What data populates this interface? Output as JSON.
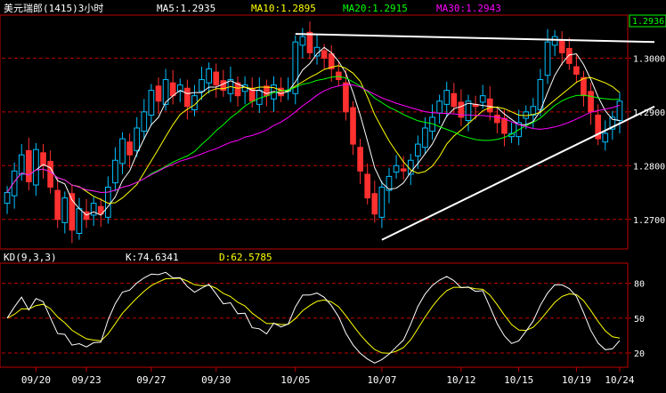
{
  "header": {
    "symbol": "美元瑞郎(1415)3小时",
    "ma5": "MA5:1.2935",
    "ma10": "MA10:1.2895",
    "ma20": "MA20:1.2915",
    "ma30": "MA30:1.2943",
    "last_price": "1.2936"
  },
  "kd_header": {
    "name": "KD(9,3,3)",
    "k": "K:74.6341",
    "d": "D:62.5785"
  },
  "colors": {
    "background": "#000000",
    "frame": "#c00000",
    "up_candle": "#00c0ff",
    "down_candle": "#ff3030",
    "ma5": "#ffffff",
    "ma10": "#ffff00",
    "ma20": "#00ff00",
    "ma30": "#ff00ff",
    "trendline": "#ffffff",
    "k_line": "#ffffff",
    "d_line": "#ffff00",
    "axis_text": "#ffffff",
    "header_text": "#ffffff"
  },
  "chart_data": [
    {
      "type": "candlestick",
      "title": "美元瑞郎(1415)3小时",
      "ylim": [
        1.265,
        1.3075
      ],
      "ytick_labels": [
        "1.3000",
        "1.2900",
        "1.2800",
        "1.2700"
      ],
      "yticks": [
        1.3,
        1.29,
        1.28,
        1.27
      ],
      "xtick_labels": [
        "09/20",
        "09/23",
        "09/27",
        "09/30",
        "10/05",
        "10/07",
        "10/12",
        "10/15",
        "10/19",
        "10/24"
      ],
      "close": [
        1.275,
        1.279,
        1.282,
        1.277,
        1.283,
        1.28,
        1.276,
        1.27,
        1.274,
        1.268,
        1.272,
        1.27,
        1.273,
        1.271,
        1.276,
        1.281,
        1.285,
        1.282,
        1.287,
        1.29,
        1.294,
        1.292,
        1.296,
        1.293,
        1.295,
        1.291,
        1.293,
        1.296,
        1.298,
        1.295,
        1.294,
        1.296,
        1.293,
        1.295,
        1.292,
        1.294,
        1.293,
        1.295,
        1.293,
        1.294,
        1.303,
        1.304,
        1.301,
        1.302,
        1.3,
        1.298,
        1.296,
        1.29,
        1.284,
        1.279,
        1.274,
        1.271,
        1.276,
        1.278,
        1.28,
        1.279,
        1.281,
        1.284,
        1.287,
        1.289,
        1.292,
        1.294,
        1.291,
        1.289,
        1.292,
        1.291,
        1.293,
        1.29,
        1.288,
        1.286,
        1.286,
        1.288,
        1.29,
        1.291,
        1.296,
        1.303,
        1.304,
        1.301,
        1.299,
        1.297,
        1.293,
        1.29,
        1.285,
        1.286,
        1.289,
        1.292
      ],
      "series": [
        {
          "name": "MA5",
          "value": 1.2935
        },
        {
          "name": "MA10",
          "value": 1.2895
        },
        {
          "name": "MA20",
          "value": 1.2915
        },
        {
          "name": "MA30",
          "value": 1.2943
        }
      ],
      "trendlines": [
        {
          "from": [
            "10/05",
            1.3045
          ],
          "to": [
            "10/24",
            1.303
          ]
        },
        {
          "from": [
            "10/07",
            1.2662
          ],
          "to": [
            "10/24",
            1.291
          ]
        }
      ]
    },
    {
      "type": "line",
      "title": "KD(9,3,3)",
      "ylim": [
        10,
        95
      ],
      "ytick_labels": [
        "80",
        "50",
        "20"
      ],
      "yticks": [
        80,
        50,
        20
      ],
      "series": [
        {
          "name": "K",
          "value": 74.6341
        },
        {
          "name": "D",
          "value": 62.5785
        }
      ]
    }
  ]
}
